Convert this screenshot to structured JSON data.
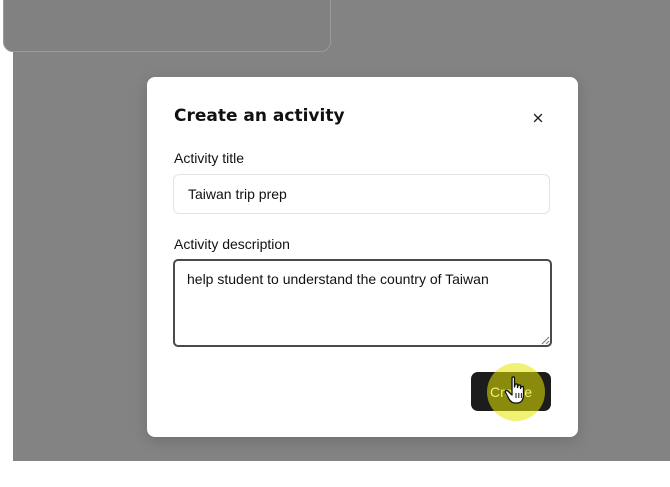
{
  "modal": {
    "title": "Create an activity",
    "close_label": "×",
    "title_field": {
      "label": "Activity title",
      "value": "Taiwan trip prep"
    },
    "description_field": {
      "label": "Activity description",
      "value": "help student to understand the country of Taiwan"
    },
    "create_button_label": "Create"
  },
  "colors": {
    "overlay": "#838383",
    "button_bg": "#1c1c1c",
    "click_highlight": "#e6e600"
  },
  "icons": {
    "close": "close-icon",
    "cursor": "hand-cursor-icon",
    "resize": "resize-grip-icon"
  }
}
